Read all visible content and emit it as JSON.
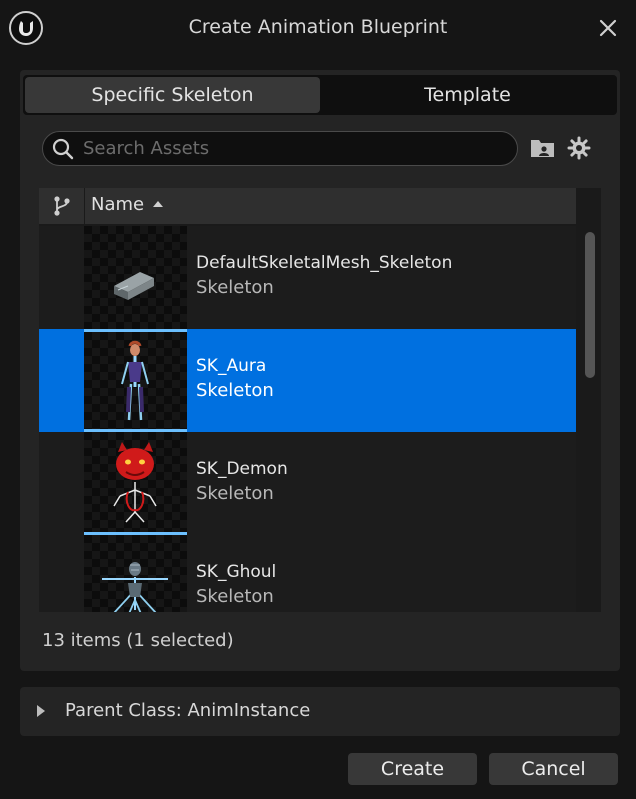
{
  "window": {
    "title": "Create Animation Blueprint"
  },
  "tabs": [
    {
      "label": "Specific Skeleton",
      "active": true
    },
    {
      "label": "Template",
      "active": false
    }
  ],
  "search": {
    "placeholder": "Search Assets",
    "value": ""
  },
  "list": {
    "column_name": "Name",
    "sort": "ascending",
    "items": [
      {
        "name": "DefaultSkeletalMesh_Skeleton",
        "type": "Skeleton",
        "selected": false
      },
      {
        "name": "SK_Aura",
        "type": "Skeleton",
        "selected": true
      },
      {
        "name": "SK_Demon",
        "type": "Skeleton",
        "selected": false
      },
      {
        "name": "SK_Ghoul",
        "type": "Skeleton",
        "selected": false
      }
    ]
  },
  "status": "13 items (1 selected)",
  "parent_class": {
    "label": "Parent Class: AnimInstance",
    "expanded": false
  },
  "buttons": {
    "create": "Create",
    "cancel": "Cancel"
  },
  "colors": {
    "selection": "#0070e0",
    "accent_bar": "#6cc0ff",
    "background": "#151515",
    "panel": "#242424"
  }
}
